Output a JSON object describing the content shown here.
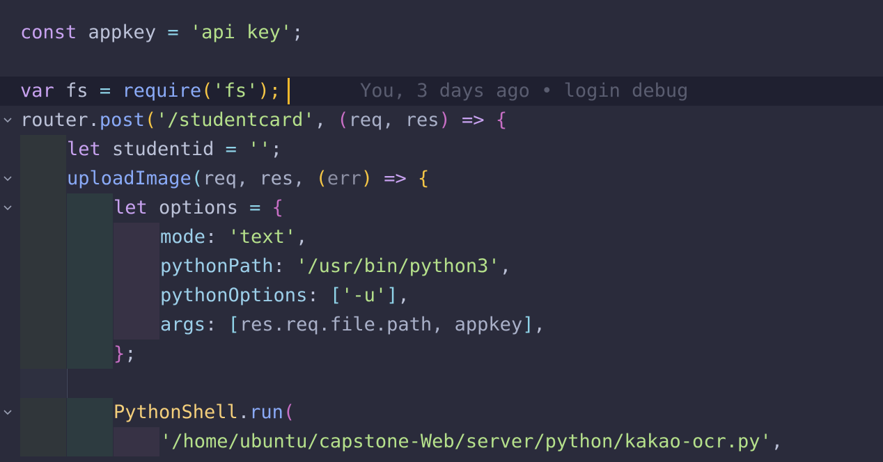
{
  "editor": {
    "blame": "You, 3 days ago • login debug",
    "lines": {
      "l1": [
        "const",
        " appkey ",
        "=",
        " ",
        "'api key'",
        ";"
      ],
      "l3": [
        "var",
        " fs ",
        "=",
        " ",
        "require",
        "(",
        "'fs'",
        ");"
      ],
      "l4": [
        "router",
        ".",
        "post",
        "(",
        "'/studentcard'",
        ", ",
        "(",
        "req, res",
        ")",
        " ",
        "=>",
        " ",
        "{"
      ],
      "l5": [
        "let",
        " studentid ",
        "=",
        " ",
        "''",
        ";"
      ],
      "l6": [
        "uploadImage",
        "(",
        "req, res, ",
        "(",
        "err",
        ")",
        " ",
        "=>",
        " ",
        "{"
      ],
      "l7": [
        "let",
        " options ",
        "=",
        " ",
        "{"
      ],
      "l8": [
        "mode",
        ": ",
        "'text'",
        ","
      ],
      "l9": [
        "pythonPath",
        ": ",
        "'/usr/bin/python3'",
        ","
      ],
      "l10": [
        "pythonOptions",
        ": ",
        "[",
        "'-u'",
        "]",
        ","
      ],
      "l11": [
        "args",
        ": ",
        "[",
        "res.req.file.path, appkey",
        "]",
        ","
      ],
      "l12": [
        "}",
        ";"
      ],
      "l14": [
        "PythonShell",
        ".",
        "run",
        "("
      ],
      "l15": [
        "'/home/ubuntu/capstone-Web/server/python/kakao-ocr.py'",
        ","
      ]
    }
  }
}
